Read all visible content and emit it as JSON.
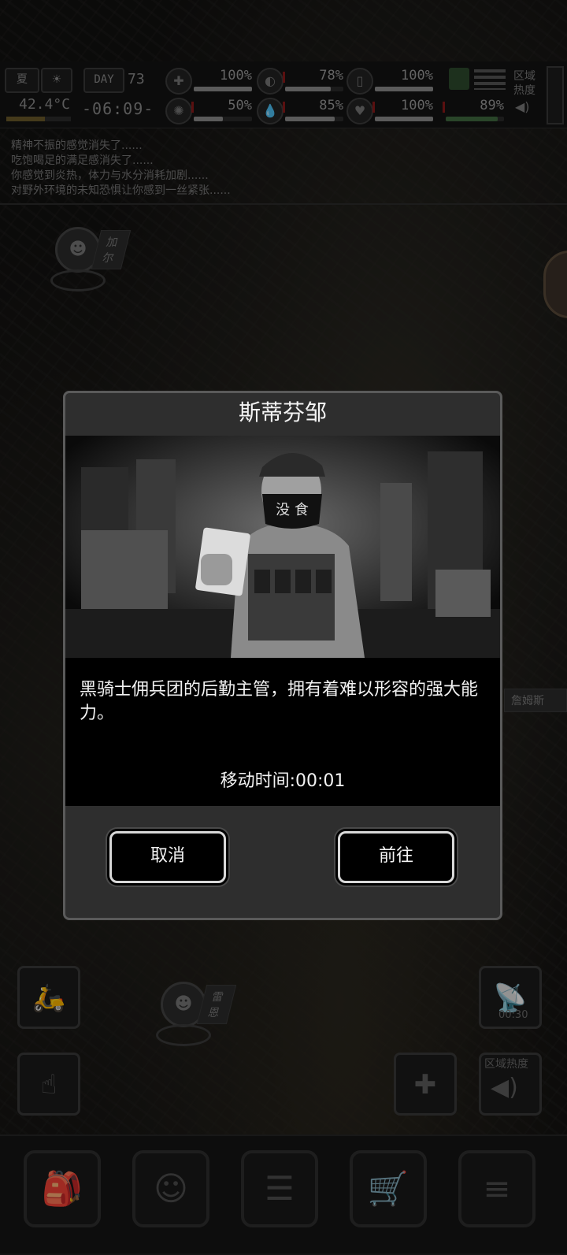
{
  "hud": {
    "season": "夏",
    "day_label": "DAY",
    "day_number": "73",
    "temperature": "42.4°C",
    "clock": "-06:09-",
    "zone_heat_label_top": "区域\n热度",
    "stats_top": [
      {
        "icon": "medkit-icon",
        "value": "100%",
        "fill": 1.0
      },
      {
        "icon": "stomach-icon",
        "value": "78%",
        "fill": 0.78
      },
      {
        "icon": "bladder-icon",
        "value": "100%",
        "fill": 1.0
      }
    ],
    "stats_bottom": [
      {
        "icon": "brain-icon",
        "value": "50%",
        "fill": 0.5
      },
      {
        "icon": "water-drop-icon",
        "value": "85%",
        "fill": 0.85
      },
      {
        "icon": "heart-icon",
        "value": "100%",
        "fill": 1.0
      },
      {
        "icon": "stamina-icon",
        "value": "89%",
        "fill": 0.89
      }
    ]
  },
  "messages": [
    "精神不振的感觉消失了......",
    "吃饱喝足的满足感消失了......",
    "你感觉到炎热，体力与水分消耗加剧......",
    "对野外环境的未知恐惧让你感到一丝紧张......"
  ],
  "map": {
    "pins": [
      {
        "name": "加尔"
      },
      {
        "name": "雷恩"
      },
      {
        "name": "詹姆斯"
      }
    ],
    "radio_timer": "00:30",
    "zone_heat_label": "区域热度"
  },
  "dialog": {
    "title": "斯蒂芬邹",
    "mask_text": "没 食",
    "description": "黑骑士佣兵团的后勤主管，拥有着难以形容的强大能力。",
    "travel_time": "移动时间:00:01",
    "cancel_label": "取消",
    "go_label": "前往"
  }
}
